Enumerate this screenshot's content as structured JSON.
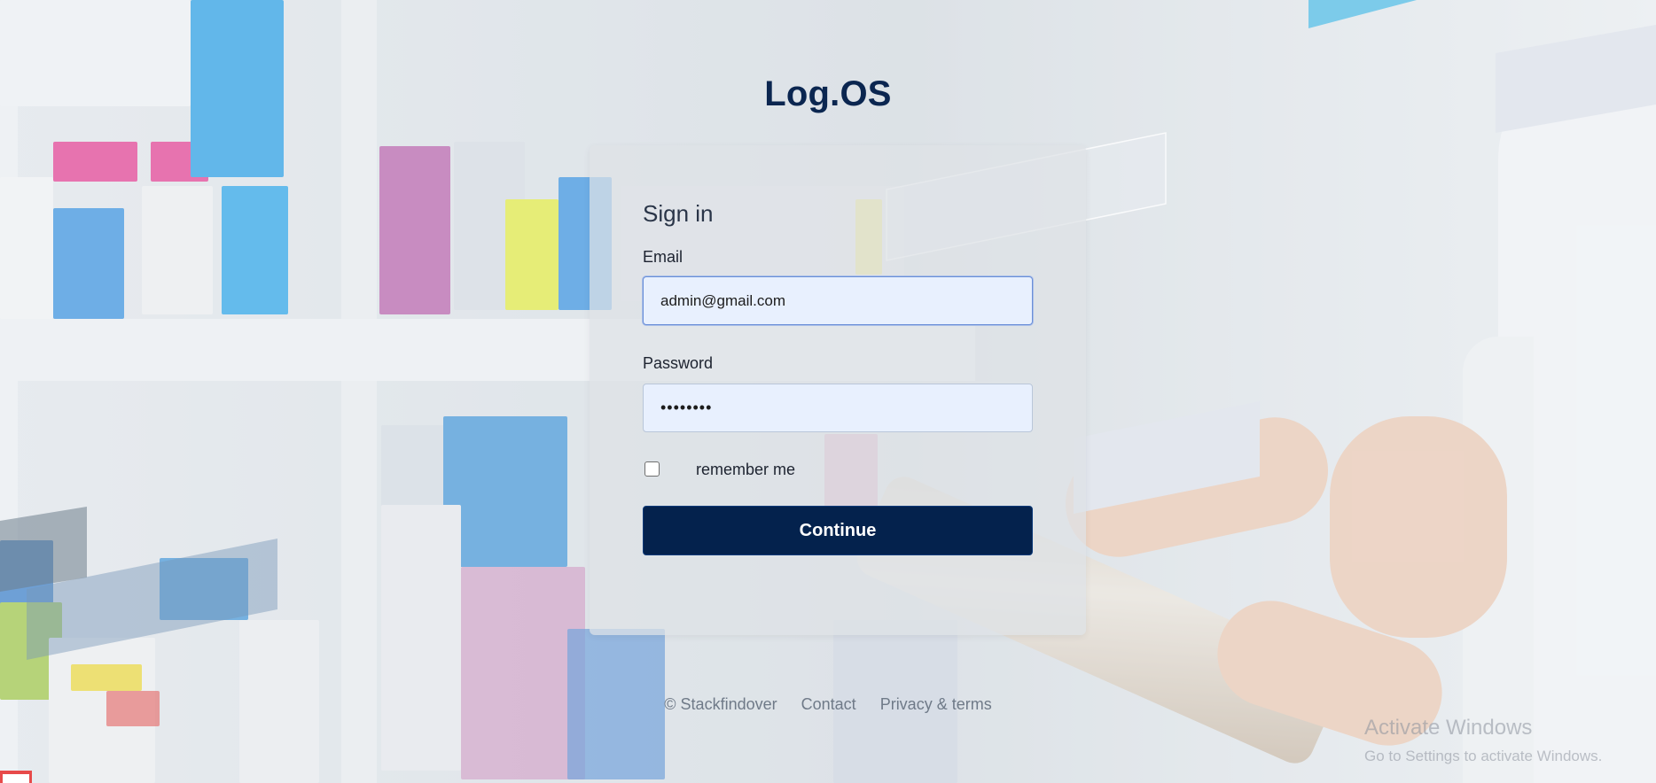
{
  "brand": {
    "logo_text": "Log.OS"
  },
  "signin": {
    "title": "Sign in",
    "email_label": "Email",
    "email_value": "admin@gmail.com",
    "password_label": "Password",
    "password_value": "••••••••",
    "remember_label": "remember me",
    "remember_checked": false,
    "continue_label": "Continue"
  },
  "footer": {
    "copyright": "© Stackfindover",
    "contact": "Contact",
    "privacy": "Privacy & terms"
  },
  "os_watermark": {
    "line1": "Activate Windows",
    "line2": "Go to Settings to activate Windows."
  },
  "colors": {
    "primary": "#04224d",
    "logo": "#0b2650",
    "input_bg": "#e8f0fe",
    "deco_blue": "#7ccbea"
  }
}
